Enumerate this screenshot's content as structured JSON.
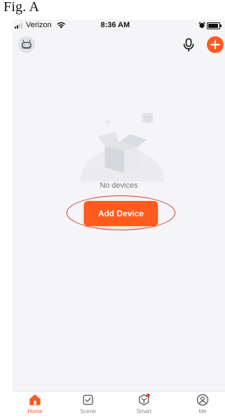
{
  "figure_caption": "Fig. A",
  "status_bar": {
    "carrier": "Verizon",
    "time": "8:36 AM",
    "battery_level": 0.9
  },
  "header": {
    "avatar_icon": "robot-avatar-icon",
    "mic_icon": "microphone-icon",
    "add_icon": "plus-icon"
  },
  "empty_state": {
    "message": "No devices",
    "button_label": "Add Device"
  },
  "tab_bar": {
    "items": [
      {
        "label": "Home",
        "icon": "home-icon",
        "active": true
      },
      {
        "label": "Scene",
        "icon": "checkbox-icon",
        "active": false
      },
      {
        "label": "Smart",
        "icon": "cube-icon",
        "active": false,
        "badge": true
      },
      {
        "label": "Me",
        "icon": "user-icon",
        "active": false
      }
    ]
  },
  "colors": {
    "accent": "#ff5b1f",
    "annotation": "#d33b3b",
    "background": "#f5f5f7"
  }
}
